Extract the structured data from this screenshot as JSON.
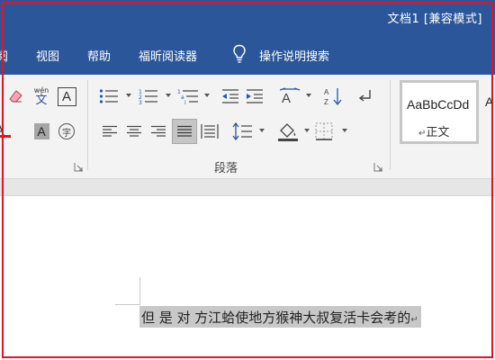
{
  "window": {
    "title": "文档1 [兼容模式]"
  },
  "tabs": [
    {
      "label": "阅"
    },
    {
      "label": "视图"
    },
    {
      "label": "帮助"
    },
    {
      "label": "福昕阅读器"
    }
  ],
  "tell_me": {
    "label": "操作说明搜索"
  },
  "ribbon": {
    "font_group": {
      "phonetic_label": "wén",
      "phonetic_char": "文",
      "charborder_char": "A",
      "shade_char": "A",
      "enclose_char": "字",
      "fontcolor_char": "A"
    },
    "paragraph_group": {
      "label": "段落"
    },
    "styles": {
      "sample": "AaBbCcDd",
      "name": "正文",
      "mark": "↵",
      "next_sample": "A"
    }
  },
  "document": {
    "text": "但 是 对 方江蛤使地方猴神大叔复活卡会考的",
    "mark": "↵"
  },
  "colors": {
    "title_bar": "#2b579a",
    "ribbon_bg": "#f3f3f3",
    "highlight": "#c8c8c8",
    "annotation_red": "#e81123"
  }
}
